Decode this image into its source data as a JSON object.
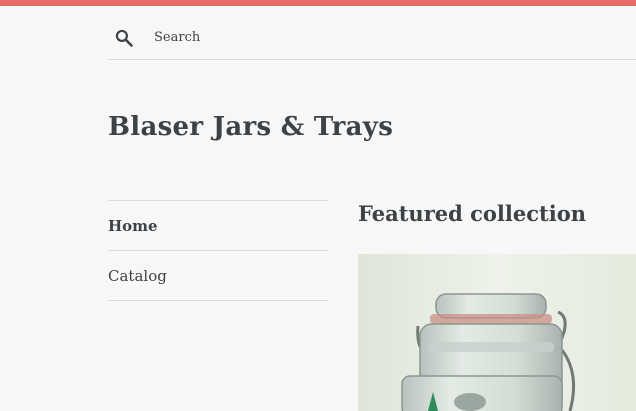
{
  "header": {
    "search_placeholder": "Search",
    "search_icon": "search-icon"
  },
  "site": {
    "title": "Blaser Jars & Trays"
  },
  "nav": {
    "items": [
      {
        "label": "Home",
        "active": true
      },
      {
        "label": "Catalog",
        "active": false
      }
    ]
  },
  "main": {
    "section_title": "Featured collection"
  },
  "colors": {
    "accent_bar": "#e86a68",
    "background": "#f7f7f7",
    "text": "#3d4246",
    "divider": "#dcdcdc"
  }
}
